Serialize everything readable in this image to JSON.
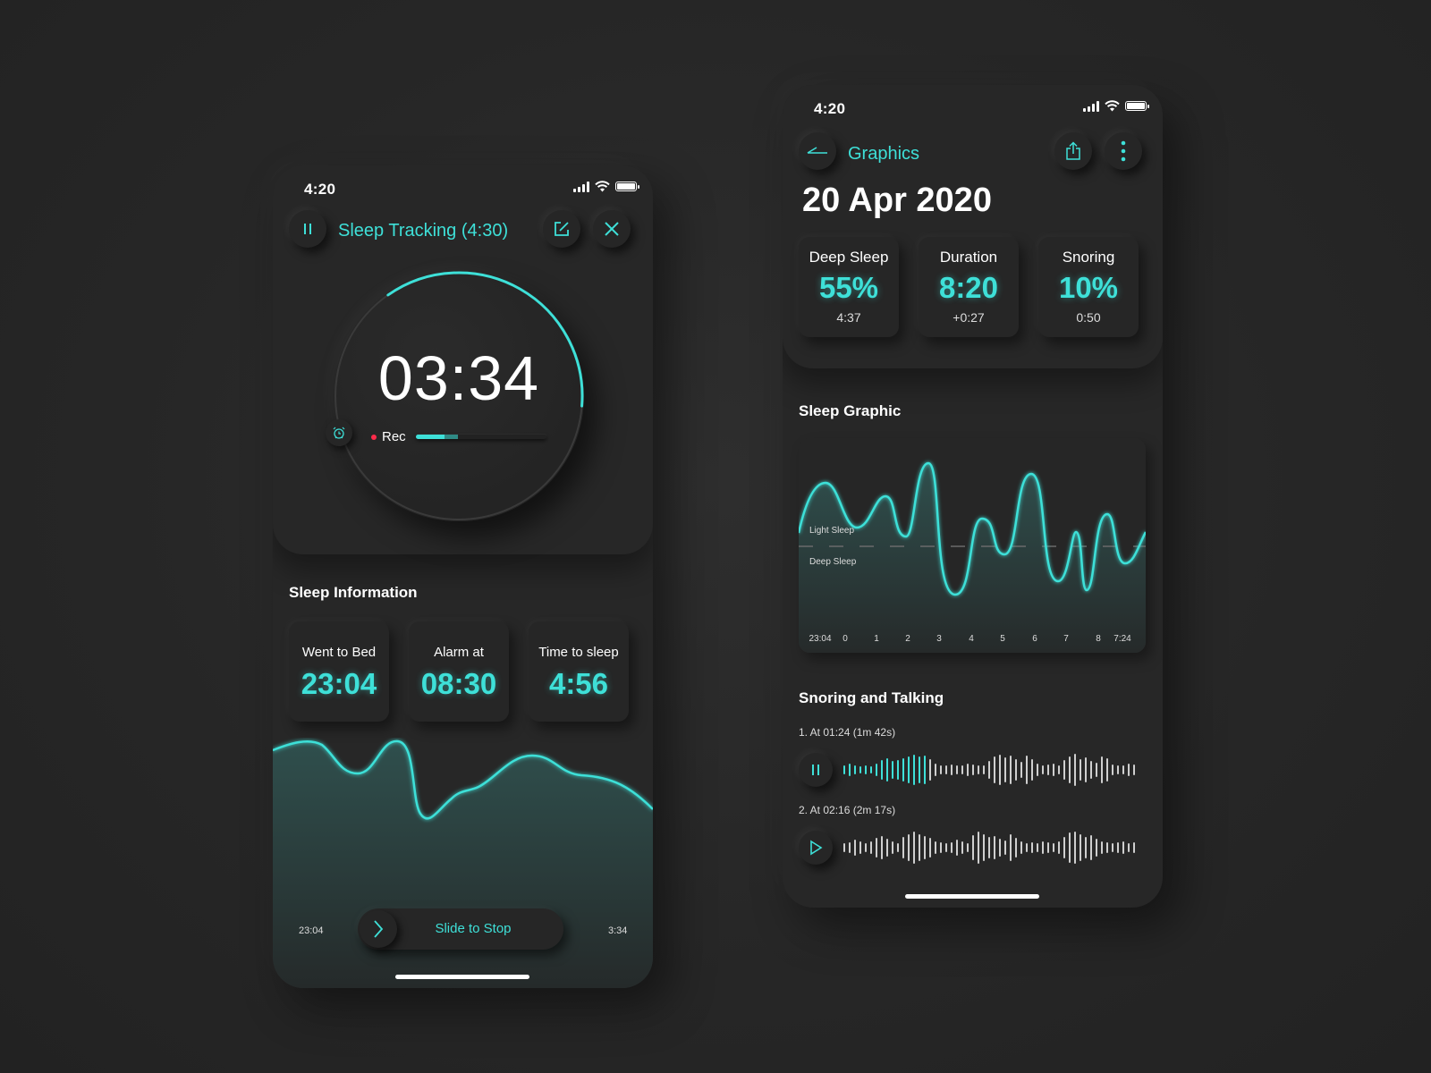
{
  "colors": {
    "accent": "#3ee0d8",
    "rec_dot": "#ff2b4a",
    "background": "#262626",
    "text": "#ffffff"
  },
  "left_screen": {
    "status_time": "4:20",
    "header": {
      "title": "Sleep Tracking (4:30)",
      "icons": [
        "pause-icon",
        "edit-icon",
        "close-icon"
      ]
    },
    "timer": {
      "elapsed": "03:34",
      "rec_label": "Rec",
      "recording_progress": 0.32,
      "dial_progress": 0.36
    },
    "sleep_information": {
      "title": "Sleep Information",
      "cards": [
        {
          "label": "Went to Bed",
          "value": "23:04"
        },
        {
          "label": "Alarm at",
          "value": "08:30"
        },
        {
          "label": "Time to sleep",
          "value": "4:56"
        }
      ]
    },
    "chart": {
      "start_label": "23:04",
      "end_label": "3:34"
    },
    "slider": {
      "label": "Slide to Stop"
    }
  },
  "right_screen": {
    "status_time": "4:20",
    "header": {
      "title": "Graphics",
      "icons": [
        "back-arrow-icon",
        "share-icon",
        "more-vertical-icon"
      ]
    },
    "date": "20 Apr 2020",
    "stats": [
      {
        "label": "Deep Sleep",
        "value": "55%",
        "sub": "4:37"
      },
      {
        "label": "Duration",
        "value": "8:20",
        "sub": "+0:27"
      },
      {
        "label": "Snoring",
        "value": "10%",
        "sub": "0:50"
      }
    ],
    "sleep_graphic": {
      "title": "Sleep Graphic",
      "upper_label": "Light Sleep",
      "lower_label": "Deep Sleep",
      "ticks": [
        "23:04",
        "0",
        "1",
        "2",
        "3",
        "4",
        "5",
        "6",
        "7",
        "8",
        "7:24"
      ]
    },
    "snoring": {
      "title": "Snoring and Talking",
      "recordings": [
        {
          "label": "1. At 01:24 (1m 42s)",
          "state": "playing",
          "played_fraction": 0.17
        },
        {
          "label": "2. At 02:16 (2m 17s)",
          "state": "paused",
          "played_fraction": 0
        }
      ]
    }
  }
}
